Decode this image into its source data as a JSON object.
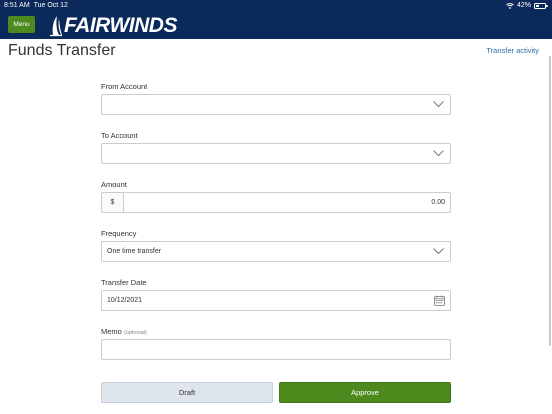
{
  "status_bar": {
    "time": "8:51 AM",
    "date": "Tue Oct 12",
    "battery_percent": "42%",
    "battery_level": 0.42,
    "icons": [
      "wifi-icon",
      "battery-icon"
    ]
  },
  "header": {
    "menu_label": "Menu",
    "logo_text": "FAIRWINDS",
    "background": "#0b2a5b",
    "accent": "#4d8a1e"
  },
  "page": {
    "title": "Funds Transfer",
    "activity_link": "Transfer activity"
  },
  "form": {
    "from_account": {
      "label": "From Account",
      "value": ""
    },
    "to_account": {
      "label": "To Account",
      "value": ""
    },
    "amount": {
      "label": "Amount",
      "currency_symbol": "$",
      "value": "0.00"
    },
    "frequency": {
      "label": "Frequency",
      "value": "One time transfer"
    },
    "transfer_date": {
      "label": "Transfer Date",
      "value": "10/12/2021"
    },
    "memo": {
      "label": "Memo",
      "optional_label": "(optional)",
      "value": ""
    }
  },
  "actions": {
    "draft_label": "Draft",
    "approve_label": "Approve"
  }
}
